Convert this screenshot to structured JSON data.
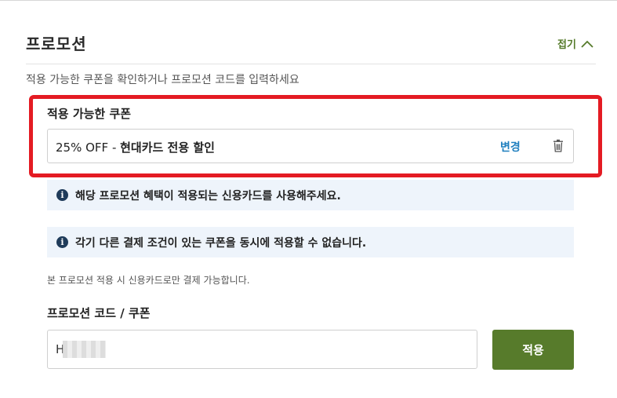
{
  "promotion": {
    "title": "프로모션",
    "collapse_label": "접기",
    "subtitle": "적용 가능한 쿠폰을 확인하거나 프로모션 코드를 입력하세요"
  },
  "coupon": {
    "section_label": "적용 가능한 쿠폰",
    "discount": "25% OFF - ",
    "name": "현대카드 전용 할인",
    "change_label": "변경"
  },
  "notices": [
    "해당 프로모션 혜택이 적용되는 신용카드를 사용해주세요.",
    "각기 다른 결제 조건이 있는 쿠폰을 동시에 적용할 수 없습니다."
  ],
  "note": "본 프로모션 적용 시 신용카드로만 결제 가능합니다.",
  "code_entry": {
    "label": "프로모션 코드 / 쿠폰",
    "value": "H",
    "apply_label": "적용"
  },
  "colors": {
    "accent_green": "#577b2b",
    "highlight_red": "#e41b23",
    "link_blue": "#1f7fbf",
    "info_bg": "#eef4fb"
  },
  "icons": [
    "chevron-up-icon",
    "trash-icon",
    "info-icon"
  ]
}
